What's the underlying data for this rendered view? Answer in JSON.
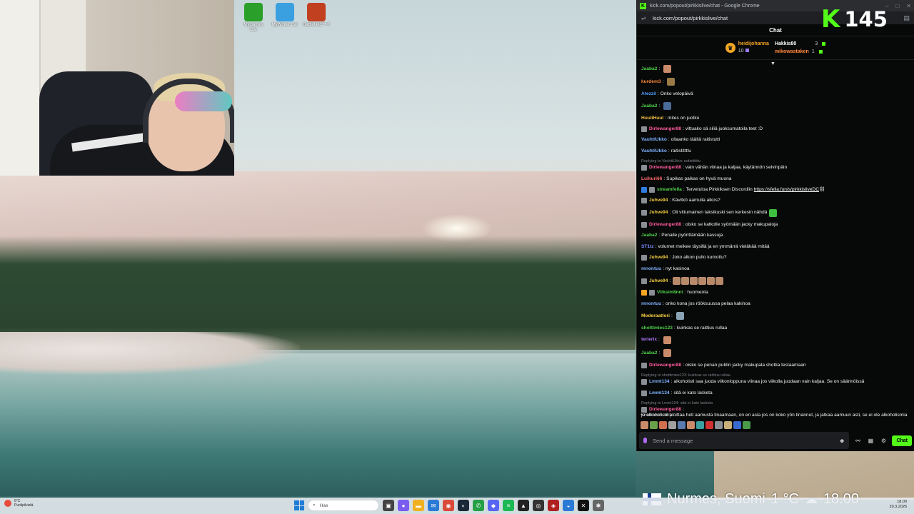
{
  "desktop_icons": [
    {
      "label": "MyGames Car",
      "color": "#2aa02a",
      "icon": "game-car-icon"
    },
    {
      "label": "MyWinter Car",
      "color": "#3aa0e0",
      "icon": "winter-car-icon"
    },
    {
      "label": "Battlefield™ 6",
      "color": "#c04020",
      "icon": "battlefield-icon"
    }
  ],
  "browser": {
    "title": "kick.com/popout/pirkkislive/chat - Google Chrome",
    "url": "kick.com/popout/pirkkislive/chat"
  },
  "chat": {
    "header": "Chat",
    "leaderboard": {
      "first": {
        "name": "heidijohanna",
        "count": "10"
      },
      "second": {
        "name": "Hakkis80",
        "count": "3"
      },
      "third": {
        "name": "mikowastaken",
        "count": "1"
      }
    },
    "messages": [
      {
        "user": "Jaaba2",
        "text": "",
        "color": "#4fd04a",
        "emote": "#c98b6a",
        "badges": []
      },
      {
        "user": "kurdem3",
        "text": "",
        "color": "#ff8a3d",
        "emote": "#9a7a45",
        "badges": []
      },
      {
        "user": "Atezzil",
        "text": "Onko vetopäivä",
        "color": "#4ea3ff",
        "badges": []
      },
      {
        "user": "Jaaba2",
        "text": "",
        "color": "#4fd04a",
        "emote": "#4a6a9a",
        "badges": []
      },
      {
        "user": "HuuliHuul",
        "text": "mites on juotko",
        "color": "#f0c040",
        "badges": []
      },
      {
        "user": "Dirlewanger88",
        "text": "vittuako sä siliä juoksumatoila teet :D",
        "color": "#ff5c9d",
        "badges": [
          "#8a8f96"
        ]
      },
      {
        "user": "VauhtiUkko",
        "text": "ollaanko täällä raitistutti",
        "color": "#7fb3ff",
        "badges": []
      },
      {
        "user": "VauhtiUkko",
        "text": "raitistittttu",
        "color": "#7fb3ff",
        "badges": []
      },
      {
        "reply": "Replying to VauhtiUkko: raitistittttu"
      },
      {
        "user": "Dirlewanger88",
        "text": "vain vähän viinaa ja kaljaa, käytännön selvinpäin",
        "color": "#ff5c9d",
        "badges": [
          "#8a8f96"
        ]
      },
      {
        "user": "Luikuri66",
        "text": "Supikas paikas on hyvä muona",
        "color": "#ff6b6b",
        "badges": []
      },
      {
        "user": "streamfella",
        "text": "Tervetuloa Pirkkiksen Discordiin",
        "link": "https://sfella.fun/s/pirkkisliveDC",
        "color": "#4fd04a",
        "badges": [
          "#2f7de1",
          "#8a8f96"
        ]
      },
      {
        "user": "Juhve94",
        "text": "Kävitkö aamulla alkos?",
        "color": "#f5d040",
        "badges": [
          "#8a8f96"
        ]
      },
      {
        "user": "Juhve94",
        "text": "Oli vittumainen taksikuski sen kerkesin nähdä",
        "color": "#f5d040",
        "emote": "#3fbf3f",
        "badges": [
          "#8a8f96"
        ]
      },
      {
        "user": "Dirlewanger88",
        "text": "oisko se katkolle syömään jacky makupaloja",
        "color": "#ff5c9d",
        "badges": [
          "#8a8f96"
        ]
      },
      {
        "user": "Jaaba2",
        "text": "Penalle pyörittämään kassuja",
        "color": "#4fd04a",
        "badges": []
      },
      {
        "user": "ST1tz",
        "text": "volumet meikee täysillä ja en ymmärrä vieläkää mitää",
        "color": "#7a8cff",
        "badges": []
      },
      {
        "user": "Juhve94",
        "text": "Joko alkon pullo kumottu?",
        "color": "#f5d040",
        "badges": [
          "#8a8f96"
        ]
      },
      {
        "user": "mnontuu",
        "text": "nyt kasinoa",
        "color": "#7fb3ff",
        "badges": []
      },
      {
        "user": "Juhve94",
        "text": "",
        "color": "#f5d040",
        "emote_row": 6,
        "badges": [
          "#8a8f96"
        ]
      },
      {
        "user": "Viiksim8nni",
        "text": "huomenta",
        "color": "#4fd04a",
        "badges": [
          "#f5a623",
          "#8a8f96"
        ]
      },
      {
        "user": "mnontuu",
        "text": "onko kona jos rööksuussa pelaa kakinoa",
        "color": "#7fb3ff",
        "badges": []
      },
      {
        "user": "Moderaattori",
        "text": "",
        "color": "#f5d040",
        "emote": "#8aa2b5",
        "badges": []
      },
      {
        "user": "shottimies123",
        "text": "kuinkas se raittius rullaa",
        "color": "#4fd04a",
        "badges": []
      },
      {
        "user": "terierix",
        "text": "",
        "color": "#b07bff",
        "emote": "#c98b6a",
        "badges": []
      },
      {
        "user": "Jaaba2",
        "text": "",
        "color": "#4fd04a",
        "emote": "#c98b6a",
        "badges": []
      },
      {
        "user": "Dirlewanger88",
        "text": "oisko se penan publin jacky makupala shottia testaamaan",
        "color": "#ff5c9d",
        "badges": [
          "#8a8f96"
        ]
      },
      {
        "reply": "Replying to shottimies123: kuinkas se raittius rullaa"
      },
      {
        "user": "Lmml134",
        "text": "alkoholisti saa juoda viikonloppuna viinaa jos viikolla juodaan vain kaljaa. Se on säännöissä",
        "color": "#7fb3ff",
        "badges": [
          "#8a8f96"
        ]
      },
      {
        "user": "Lmml134",
        "text": "sitä ei kato lasketa",
        "color": "#7fb3ff",
        "badges": [
          "#8a8f96"
        ]
      },
      {
        "reply": "Replying to Lmml134: sitä ei kato lasketa"
      },
      {
        "user": "Dirlewanger88",
        "text": "ja alkoholistit aloittaa heti aamusta tinaamaan, on eri asia jos on koko yön tinannut, ja jatkaa aamuun asti, se ei ole alkoholismia",
        "color": "#ff5c9d",
        "badges": [
          "#8a8f96"
        ]
      }
    ],
    "followers_only": "Followers only",
    "emote_bar": [
      "#c98b6a",
      "#6aa04a",
      "#d07050",
      "#a0a0a0",
      "#5a7ab0",
      "#c98b6a",
      "#3aa0a0",
      "#d03030",
      "#8a8f96",
      "#c9b07a",
      "#3a6ad0",
      "#4a9a4a"
    ],
    "input_placeholder": "Send a message",
    "send_label": "Chat"
  },
  "viewer_count": "145",
  "weather_overlay": {
    "location": "Nurmes, Suomi",
    "temp": "1 °C",
    "time": "18.00"
  },
  "taskbar": {
    "weather_temp": "6°C",
    "weather_desc": "Puolipilvistä",
    "search_placeholder": "Hae",
    "clock_time": "18.00",
    "clock_date": "20.3.2026",
    "apps": [
      {
        "name": "task-view-icon",
        "color": "#444",
        "glyph": "▣"
      },
      {
        "name": "copilot-icon",
        "color": "#7a5cf0",
        "glyph": "●"
      },
      {
        "name": "file-explorer-icon",
        "color": "#f0b020",
        "glyph": "▬"
      },
      {
        "name": "mail-icon",
        "color": "#2a7ad6",
        "glyph": "✉"
      },
      {
        "name": "chrome-icon",
        "color": "#d94a3a",
        "glyph": "◉"
      },
      {
        "name": "steam-icon",
        "color": "#1b2838",
        "glyph": "◐"
      },
      {
        "name": "whatsapp-icon",
        "color": "#25a045",
        "glyph": "✆"
      },
      {
        "name": "discord-icon",
        "color": "#5865f2",
        "glyph": "◆"
      },
      {
        "name": "spotify-icon",
        "color": "#1db954",
        "glyph": "≡"
      },
      {
        "name": "epic-icon",
        "color": "#222",
        "glyph": "▲"
      },
      {
        "name": "obs-icon",
        "color": "#333",
        "glyph": "◎"
      },
      {
        "name": "game-icon",
        "color": "#b02020",
        "glyph": "◈"
      },
      {
        "name": "browser-icon",
        "color": "#2a7ad6",
        "glyph": "◒"
      },
      {
        "name": "capcut-icon",
        "color": "#111",
        "glyph": "✕"
      },
      {
        "name": "app-extra-icon",
        "color": "#666",
        "glyph": "✱"
      }
    ]
  }
}
